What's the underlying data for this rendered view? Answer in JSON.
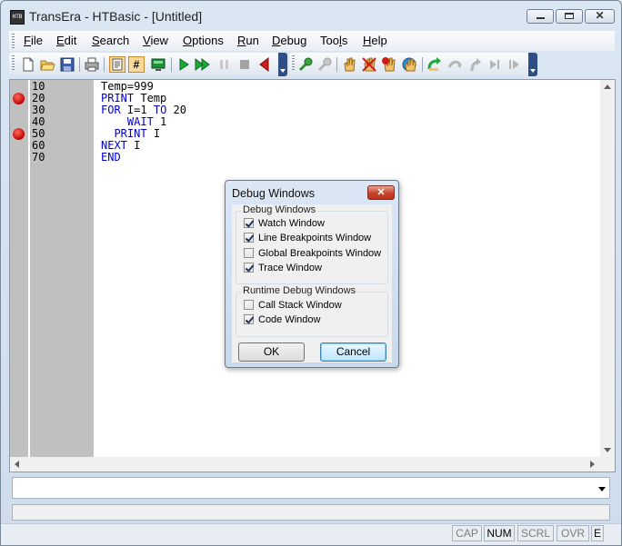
{
  "window": {
    "app_icon_text": "HTB",
    "title": "TransEra - HTBasic - [Untitled]"
  },
  "menu": [
    {
      "label": "File",
      "mnemonic": "F",
      "rest": "ile"
    },
    {
      "label": "Edit",
      "mnemonic": "E",
      "rest": "dit"
    },
    {
      "label": "Search",
      "mnemonic": "S",
      "rest": "earch"
    },
    {
      "label": "View",
      "mnemonic": "V",
      "rest": "iew"
    },
    {
      "label": "Options",
      "mnemonic": "O",
      "rest": "ptions"
    },
    {
      "label": "Run",
      "mnemonic": "R",
      "rest": "un"
    },
    {
      "label": "Debug",
      "mnemonic": "D",
      "rest": "ebug"
    },
    {
      "label": "Tools",
      "mnemonic": "T",
      "rest": "ools",
      "underline_index": 3
    },
    {
      "label": "Help",
      "mnemonic": "H",
      "rest": "elp"
    }
  ],
  "toolbar": {
    "icons": [
      "new-file-icon",
      "open-folder-icon",
      "save-icon",
      "print-icon",
      "program-view-icon",
      "line-numbers-icon",
      "monitor-icon",
      "run-icon",
      "continue-icon",
      "pause-icon",
      "stop-icon",
      "step-back-icon",
      "tools-icon",
      "tools-disabled-icon",
      "hand-icon",
      "clear-breakpoints-icon",
      "hand-breakpoint-icon",
      "global-breakpoint-icon",
      "step-into-icon",
      "step-over-icon",
      "step-out-icon",
      "step-icon",
      "step-end-icon"
    ],
    "line_numbers_glyph": "#"
  },
  "editor": {
    "lines": [
      {
        "num": "10",
        "code": "Temp=999",
        "breakpoint": false
      },
      {
        "num": "20",
        "code": "PRINT Temp",
        "breakpoint": true
      },
      {
        "num": "30",
        "code": "FOR I=1 TO 20",
        "breakpoint": false
      },
      {
        "num": "40",
        "code": "    WAIT 1",
        "breakpoint": false
      },
      {
        "num": "50",
        "code": "  PRINT I",
        "breakpoint": true
      },
      {
        "num": "60",
        "code": "NEXT I",
        "breakpoint": false
      },
      {
        "num": "70",
        "code": "END",
        "breakpoint": false
      }
    ],
    "keyword_color": "#0000c8",
    "breakpoint_color": "#c00000"
  },
  "dialog": {
    "title": "Debug Windows",
    "close_glyph": "✕",
    "debug_group": {
      "label": "Debug Windows",
      "options": [
        {
          "label": "Watch Window",
          "checked": true
        },
        {
          "label": "Line Breakpoints Window",
          "checked": true
        },
        {
          "label": "Global Breakpoints Window",
          "checked": false
        },
        {
          "label": "Trace Window",
          "checked": true
        }
      ]
    },
    "runtime_group": {
      "label": "Runtime Debug Windows",
      "options": [
        {
          "label": "Call Stack Window",
          "checked": false
        },
        {
          "label": "Code Window",
          "checked": true
        }
      ]
    },
    "ok_label": "OK",
    "cancel_label": "Cancel"
  },
  "command_line": {
    "value": ""
  },
  "status": [
    {
      "label": "CAP",
      "active": false
    },
    {
      "label": "NUM",
      "active": true
    },
    {
      "label": "SCRL",
      "active": false
    },
    {
      "label": "OVR",
      "active": false
    },
    {
      "label": "E",
      "active": true
    }
  ]
}
